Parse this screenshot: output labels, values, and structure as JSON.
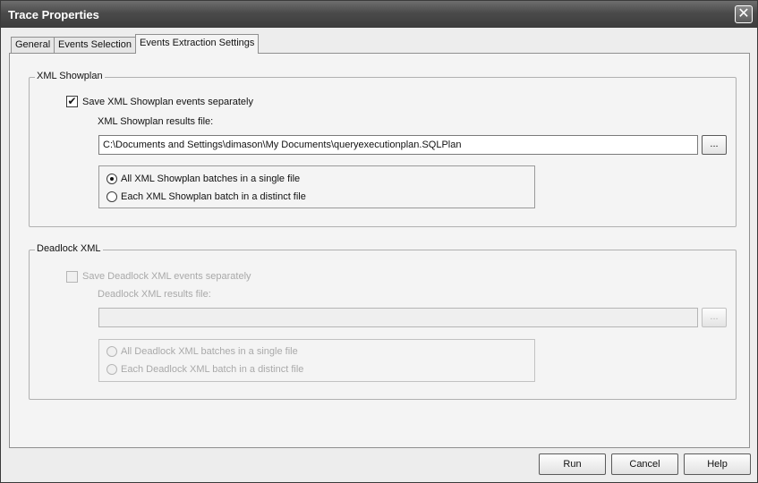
{
  "window": {
    "title": "Trace Properties",
    "close_glyph": "✕"
  },
  "tabs": [
    {
      "label": "General"
    },
    {
      "label": "Events Selection"
    },
    {
      "label": "Events Extraction Settings"
    }
  ],
  "xml_showplan": {
    "legend": "XML Showplan",
    "checkbox_label": "Save XML Showplan events separately",
    "checked": true,
    "results_label": "XML Showplan results file:",
    "results_value": "C:\\Documents and Settings\\dimason\\My Documents\\queryexecutionplan.SQLPlan",
    "browse_label": "...",
    "radio_all": "All XML Showplan batches in a single file",
    "radio_each": "Each XML Showplan batch in a distinct file",
    "selected": "all"
  },
  "deadlock_xml": {
    "legend": "Deadlock XML",
    "checkbox_label": "Save Deadlock XML events separately",
    "checked": false,
    "results_label": "Deadlock XML results file:",
    "results_value": "",
    "browse_label": "...",
    "radio_all": "All Deadlock XML batches in a single file",
    "radio_each": "Each Deadlock XML batch in a distinct file"
  },
  "footer": {
    "run": "Run",
    "cancel": "Cancel",
    "help": "Help"
  },
  "icons": {
    "check": "✔",
    "close": "close-icon"
  }
}
